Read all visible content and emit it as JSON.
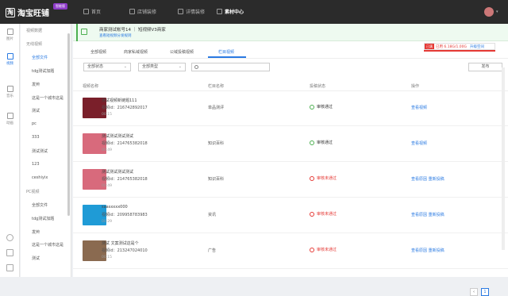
{
  "topbar": {
    "logo": "淘宝旺铺",
    "badge": "智能版",
    "nav": [
      "首页",
      "店铺装修",
      "详情装修",
      "素材中心"
    ]
  },
  "rail": {
    "items": [
      "图片",
      "视频",
      "音乐",
      "动画"
    ]
  },
  "tree": {
    "items": [
      {
        "type": "group",
        "label": "视频数据"
      },
      {
        "type": "group",
        "label": "无线视频"
      },
      {
        "type": "item",
        "label": "全部文件",
        "active": true
      },
      {
        "type": "item",
        "label": "tdg测试加题"
      },
      {
        "type": "item",
        "label": "发辫"
      },
      {
        "type": "item",
        "label": "这是一个城市这是"
      },
      {
        "type": "item",
        "label": "测试"
      },
      {
        "type": "item",
        "label": "pc"
      },
      {
        "type": "item",
        "label": "333"
      },
      {
        "type": "item",
        "label": "测试测试"
      },
      {
        "type": "item",
        "label": "123"
      },
      {
        "type": "item",
        "label": "ceshiyix"
      },
      {
        "type": "group",
        "label": "PC视频"
      },
      {
        "type": "item",
        "label": "全部文件"
      },
      {
        "type": "item",
        "label": "tdg测试加题"
      },
      {
        "type": "item",
        "label": "发辫"
      },
      {
        "type": "item",
        "label": "这是一个城市这是"
      },
      {
        "type": "item",
        "label": "测试"
      }
    ]
  },
  "account": {
    "name": "商家测试帐号14 ｜ 短视频V3商家",
    "link": "查看短视频分发规则"
  },
  "storage": {
    "tag": "已满",
    "text": "已用 6.18G/1.00G",
    "upgrade": "升级空间",
    "used_fraction": 1.0
  },
  "tabs": [
    "全部视频",
    "商家私域视频",
    "公域投稿视频",
    "栏目视频"
  ],
  "filters": {
    "status": "全部状态",
    "type": "全部类型",
    "search_placeholder": "",
    "publish": "发布"
  },
  "table": {
    "headers": [
      "视频名称",
      "栏目名称",
      "投稿状态",
      "操作"
    ],
    "rows": [
      {
        "title": "测试视频新链题111",
        "id": "视频id：216742892017",
        "duration": "00:15",
        "category": "单品测评",
        "status": "审核通过",
        "ok": true,
        "ops": "查看视频",
        "thumb": "#7a1f2a"
      },
      {
        "title": "测试测试测试测试",
        "id": "视频id：214765382018",
        "duration": "00:49",
        "category": "知识百科",
        "status": "审核通过",
        "ok": true,
        "ops": "查看视频",
        "thumb": "#d86a7c"
      },
      {
        "title": "测试测试测试测试",
        "id": "视频id：214765382018",
        "duration": "00:49",
        "category": "知识百科",
        "status": "审核未通过",
        "ok": false,
        "ops": "查看原因  重新投稿",
        "thumb": "#d86a7c"
      },
      {
        "title": "saasxxxx000",
        "id": "视频id：209958783983",
        "duration": "00:29",
        "category": "资讯",
        "status": "审核未通过",
        "ok": false,
        "ops": "查看原因  重新投稿",
        "thumb": "#1f9bd6"
      },
      {
        "title": "测试 文案测试这是个",
        "id": "视频id：213247024010",
        "duration": "00:15",
        "category": "广告",
        "status": "审核未通过",
        "ok": false,
        "ops": "查看原因  重新投稿",
        "thumb": "#8a6a50"
      }
    ]
  },
  "pager": {
    "prev": "‹",
    "page": "1"
  }
}
